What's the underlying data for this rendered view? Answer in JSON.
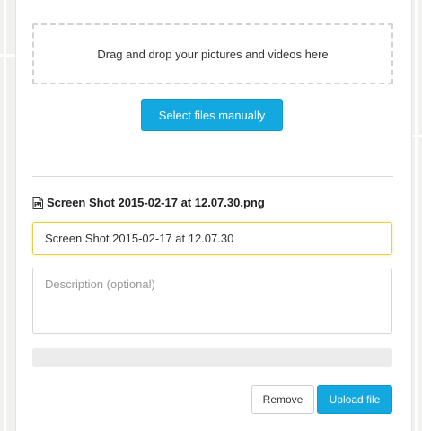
{
  "dropzone": {
    "text": "Drag and drop your pictures and videos here"
  },
  "select_button": {
    "label": "Select files manually"
  },
  "file": {
    "icon": "image-file-icon",
    "name": "Screen Shot 2015-02-17 at 12.07.30.png",
    "title_value": "Screen Shot 2015-02-17 at 12.07.30",
    "description_placeholder": "Description (optional)"
  },
  "progress": {
    "fraction": 0
  },
  "actions": {
    "remove_label": "Remove",
    "upload_label": "Upload file"
  },
  "colors": {
    "accent": "#14a8e0",
    "focus_border": "#e8cf45",
    "map_background": "#f1f1ef"
  }
}
